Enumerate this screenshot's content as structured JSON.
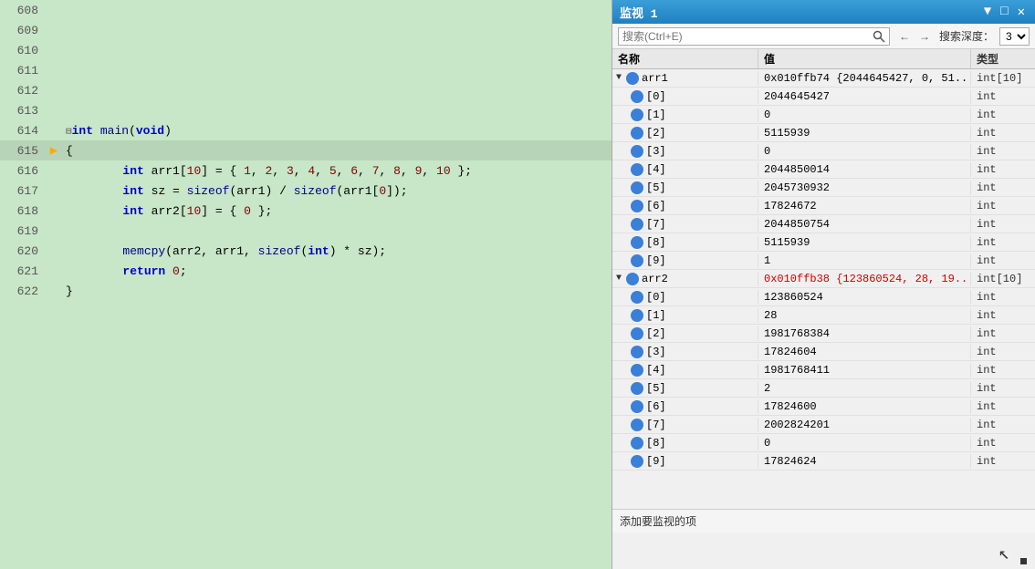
{
  "watch_panel": {
    "title": "监视 1",
    "title_buttons": [
      "▼",
      "□",
      "✕"
    ],
    "search_placeholder": "搜索(Ctrl+E)",
    "search_icon": "🔍",
    "nav_prev": "←",
    "nav_next": "→",
    "depth_label": "搜索深度：",
    "depth_value": "3",
    "columns": {
      "name": "名称",
      "value": "值",
      "type": "类型"
    },
    "footer_text": "添加要监视的项"
  },
  "watch_rows": [
    {
      "indent": 0,
      "expand": "▼",
      "icon": true,
      "name": "arr1",
      "value": "0x010ffb74 {2044645427, 0, 51...",
      "type": "int[10]",
      "red": false,
      "is_parent": true
    },
    {
      "indent": 1,
      "expand": "",
      "icon": true,
      "name": "[0]",
      "value": "2044645427",
      "type": "int",
      "red": false
    },
    {
      "indent": 1,
      "expand": "",
      "icon": true,
      "name": "[1]",
      "value": "0",
      "type": "int",
      "red": false
    },
    {
      "indent": 1,
      "expand": "",
      "icon": true,
      "name": "[2]",
      "value": "5115939",
      "type": "int",
      "red": false
    },
    {
      "indent": 1,
      "expand": "",
      "icon": true,
      "name": "[3]",
      "value": "0",
      "type": "int",
      "red": false
    },
    {
      "indent": 1,
      "expand": "",
      "icon": true,
      "name": "[4]",
      "value": "2044850014",
      "type": "int",
      "red": false
    },
    {
      "indent": 1,
      "expand": "",
      "icon": true,
      "name": "[5]",
      "value": "2045730932",
      "type": "int",
      "red": false
    },
    {
      "indent": 1,
      "expand": "",
      "icon": true,
      "name": "[6]",
      "value": "17824672",
      "type": "int",
      "red": false
    },
    {
      "indent": 1,
      "expand": "",
      "icon": true,
      "name": "[7]",
      "value": "2044850754",
      "type": "int",
      "red": false
    },
    {
      "indent": 1,
      "expand": "",
      "icon": true,
      "name": "[8]",
      "value": "5115939",
      "type": "int",
      "red": false
    },
    {
      "indent": 1,
      "expand": "",
      "icon": true,
      "name": "[9]",
      "value": "1",
      "type": "int",
      "red": false
    },
    {
      "indent": 0,
      "expand": "▼",
      "icon": true,
      "name": "arr2",
      "value": "0x010ffb38 {123860524, 28, 19...",
      "type": "int[10]",
      "red": true,
      "is_parent": true
    },
    {
      "indent": 1,
      "expand": "",
      "icon": true,
      "name": "[0]",
      "value": "123860524",
      "type": "int",
      "red": false
    },
    {
      "indent": 1,
      "expand": "",
      "icon": true,
      "name": "[1]",
      "value": "28",
      "type": "int",
      "red": false
    },
    {
      "indent": 1,
      "expand": "",
      "icon": true,
      "name": "[2]",
      "value": "1981768384",
      "type": "int",
      "red": false
    },
    {
      "indent": 1,
      "expand": "",
      "icon": true,
      "name": "[3]",
      "value": "17824604",
      "type": "int",
      "red": false
    },
    {
      "indent": 1,
      "expand": "",
      "icon": true,
      "name": "[4]",
      "value": "1981768411",
      "type": "int",
      "red": false
    },
    {
      "indent": 1,
      "expand": "",
      "icon": true,
      "name": "[5]",
      "value": "2",
      "type": "int",
      "red": false
    },
    {
      "indent": 1,
      "expand": "",
      "icon": true,
      "name": "[6]",
      "value": "17824600",
      "type": "int",
      "red": false
    },
    {
      "indent": 1,
      "expand": "",
      "icon": true,
      "name": "[7]",
      "value": "2002824201",
      "type": "int",
      "red": false
    },
    {
      "indent": 1,
      "expand": "",
      "icon": true,
      "name": "[8]",
      "value": "0",
      "type": "int",
      "red": false
    },
    {
      "indent": 1,
      "expand": "",
      "icon": true,
      "name": "[9]",
      "value": "17824624",
      "type": "int",
      "red": false
    }
  ],
  "code": {
    "lines": [
      {
        "num": 608,
        "arrow": false,
        "content": "",
        "current": false
      },
      {
        "num": 609,
        "arrow": false,
        "content": "",
        "current": false
      },
      {
        "num": 610,
        "arrow": false,
        "content": "",
        "current": false
      },
      {
        "num": 611,
        "arrow": false,
        "content": "",
        "current": false
      },
      {
        "num": 612,
        "arrow": false,
        "content": "",
        "current": false
      },
      {
        "num": 613,
        "arrow": false,
        "content": "",
        "current": false
      },
      {
        "num": 614,
        "arrow": false,
        "content": "int_main(void)",
        "current": false,
        "collapse": true
      },
      {
        "num": 615,
        "arrow": true,
        "content": "{",
        "current": true
      },
      {
        "num": 616,
        "arrow": false,
        "content": "    int arr1[10] = { 1, 2, 3, 4, 5, 6, 7, 8, 9, 10 };",
        "current": false
      },
      {
        "num": 617,
        "arrow": false,
        "content": "    int sz = sizeof(arr1) / sizeof(arr1[0]);",
        "current": false
      },
      {
        "num": 618,
        "arrow": false,
        "content": "    int arr2[10] = { 0 };",
        "current": false
      },
      {
        "num": 619,
        "arrow": false,
        "content": "",
        "current": false
      },
      {
        "num": 620,
        "arrow": false,
        "content": "    memcpy(arr2, arr1, sizeof(int) * sz);",
        "current": false
      },
      {
        "num": 621,
        "arrow": false,
        "content": "    return 0;",
        "current": false
      },
      {
        "num": 622,
        "arrow": false,
        "content": "}",
        "current": false
      }
    ]
  }
}
